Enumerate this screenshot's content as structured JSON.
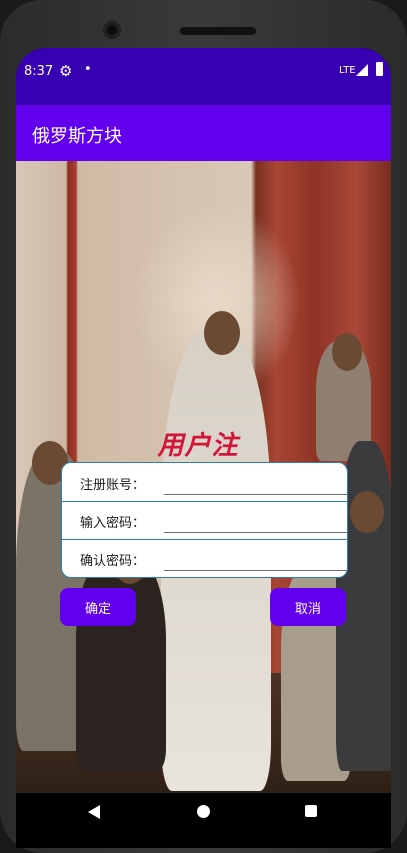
{
  "status_bar": {
    "time": "8:37",
    "network": "LTE"
  },
  "toolbar": {
    "title": "俄罗斯方块"
  },
  "form": {
    "title": "用户注册",
    "fields": [
      {
        "label": "注册账号：",
        "value": ""
      },
      {
        "label": "输入密码：",
        "value": ""
      },
      {
        "label": "确认密码：",
        "value": ""
      }
    ]
  },
  "buttons": {
    "confirm": "确定",
    "cancel": "取消"
  },
  "colors": {
    "status_bar": "#3700b3",
    "toolbar": "#6200ee",
    "button": "#6200ee",
    "title_text": "#d5143a",
    "card_border": "#2f7db4"
  }
}
